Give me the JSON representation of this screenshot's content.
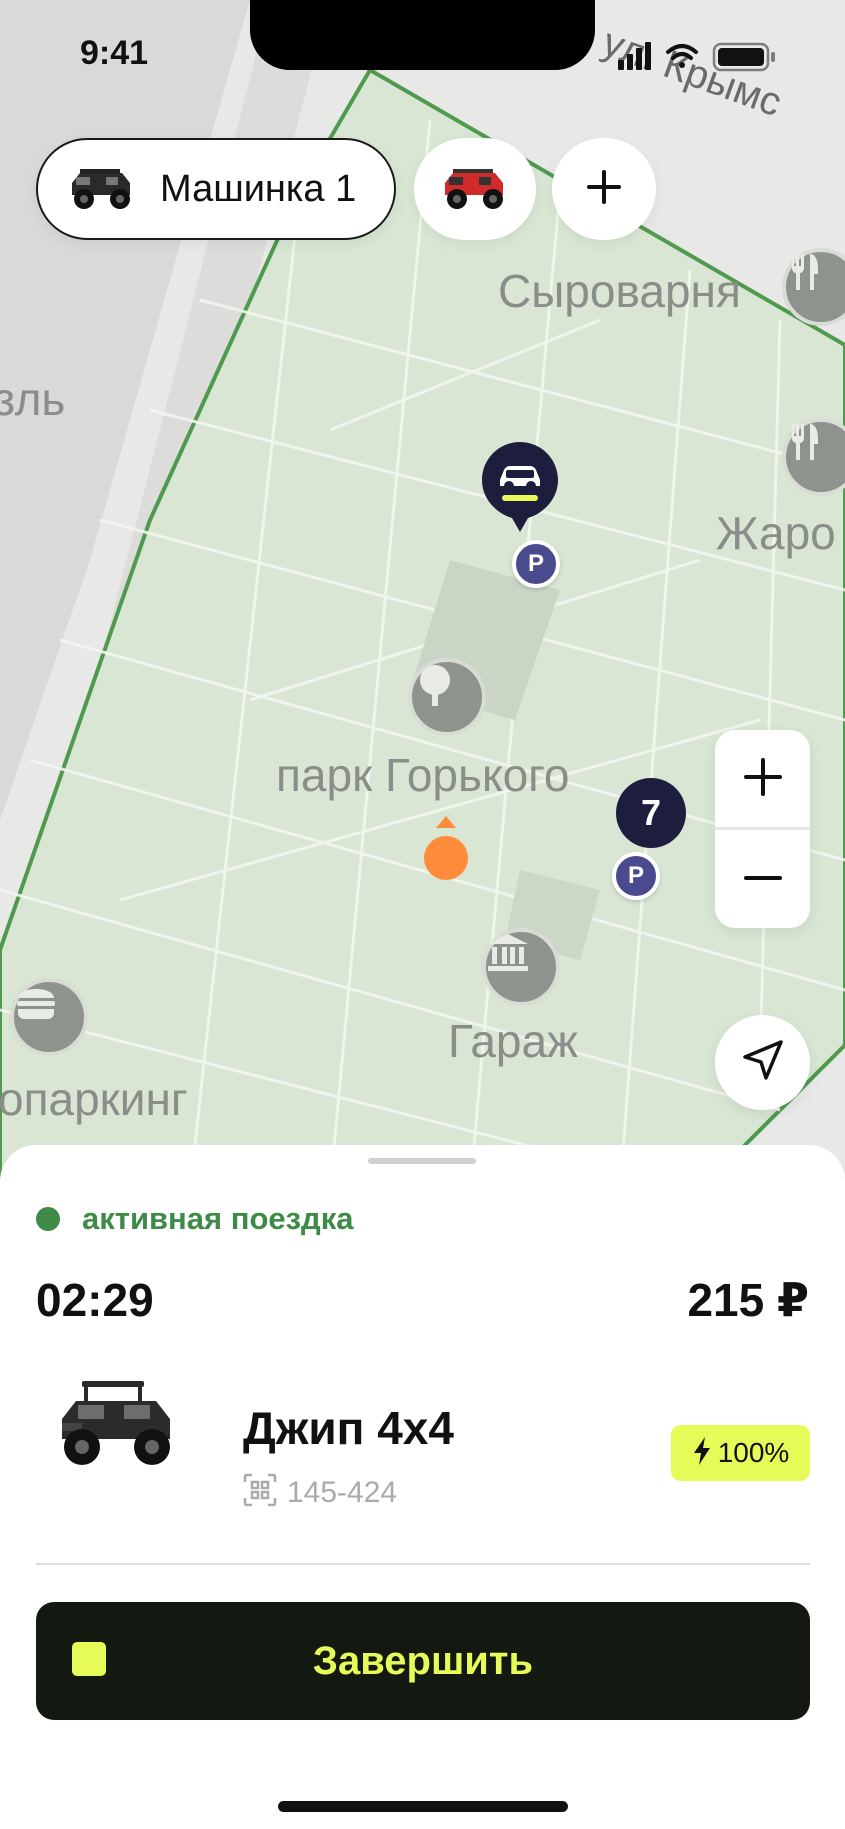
{
  "status_bar": {
    "time": "9:41"
  },
  "vehicle_chips": [
    {
      "label": "Машинка 1",
      "icon": "black-jeep-thumbnail",
      "selected": true
    },
    {
      "label": "",
      "icon": "red-jeep-thumbnail",
      "selected": false
    }
  ],
  "add_vehicle": {
    "icon": "plus-icon"
  },
  "map": {
    "labels": {
      "street": "ул. Крымс",
      "left_edge": "зль",
      "cheese": "Сыроварня",
      "zharo": "Жаро",
      "park": "парк Горького",
      "garage": "Гараж",
      "parking_lot": "опаркинг"
    },
    "parking_marker": "P",
    "cluster_count": "7",
    "zone_color": "#4f9a4f"
  },
  "zoom": {
    "in_icon": "plus-icon",
    "out_icon": "minus-icon"
  },
  "locate": {
    "icon": "navigation-arrow-icon"
  },
  "trip": {
    "status": "активная поездка",
    "timer": "02:29",
    "price": "215 ₽",
    "vehicle_name": "Джип 4x4",
    "vehicle_id": "145-424",
    "battery": "100%",
    "finish_label": "Завершить"
  },
  "colors": {
    "accent": "#e6fb58",
    "dark": "#131810",
    "active_green": "#3e8a47",
    "parking": "#4a4a8e",
    "cluster": "#1d1d3d",
    "user_location": "#ff8c3a"
  }
}
